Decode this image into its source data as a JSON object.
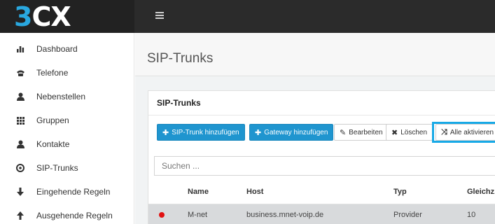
{
  "app": {
    "logo_3": "3",
    "logo_cx": "CX"
  },
  "sidebar": {
    "items": [
      {
        "label": "Dashboard"
      },
      {
        "label": "Telefone"
      },
      {
        "label": "Nebenstellen"
      },
      {
        "label": "Gruppen"
      },
      {
        "label": "Kontakte"
      },
      {
        "label": "SIP-Trunks"
      },
      {
        "label": "Eingehende Regeln"
      },
      {
        "label": "Ausgehende Regeln"
      }
    ]
  },
  "page": {
    "title": "SIP-Trunks"
  },
  "panel": {
    "title": "SIP-Trunks",
    "toolbar": {
      "add_trunk": "SIP-Trunk hinzufügen",
      "add_gateway": "Gateway hinzufügen",
      "edit": "Bearbeiten",
      "delete": "Löschen",
      "activate_all": "Alle aktivieren"
    },
    "search": {
      "placeholder": "Suchen ..."
    },
    "table": {
      "columns": [
        "Name",
        "Host",
        "Typ",
        "Gleichz."
      ],
      "rows": [
        {
          "status_color": "#e11111",
          "name": "M-net",
          "host": "business.mnet-voip.de",
          "type": "Provider",
          "simultaneous": "10"
        }
      ]
    }
  }
}
